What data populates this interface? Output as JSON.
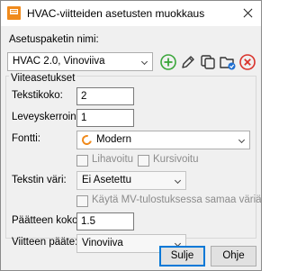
{
  "window": {
    "title": "HVAC-viitteiden asetusten muokkaus"
  },
  "preset": {
    "label": "Asetuspaketin nimi:",
    "value": "HVAC 2.0, Vinoviiva",
    "toolbar": [
      {
        "name": "add",
        "icon": "add-circle-icon",
        "color": "#3aa63a"
      },
      {
        "name": "edit",
        "icon": "pencil-icon",
        "color": "#333333"
      },
      {
        "name": "copy",
        "icon": "copy-icon",
        "color": "#333333"
      },
      {
        "name": "save",
        "icon": "folder-save-icon",
        "color": "#1f6fd1"
      },
      {
        "name": "delete",
        "icon": "delete-circle-icon",
        "color": "#d9322b"
      }
    ]
  },
  "group": {
    "title": "Viiteasetukset",
    "text_size": {
      "label": "Tekstikoko:",
      "value": "2"
    },
    "width_factor": {
      "label": "Leveyskerroin:",
      "value": "1"
    },
    "font": {
      "label": "Fontti:",
      "value": "Modern",
      "icon": "font-icon"
    },
    "bold": {
      "label": "Lihavoitu",
      "checked": false
    },
    "italic": {
      "label": "Kursivoitu",
      "checked": false
    },
    "text_color": {
      "label": "Tekstin väri:",
      "value": "Ei Asetettu"
    },
    "use_mv": {
      "label": "Käytä MV-tulostuksessa samaa väriä",
      "checked": false
    },
    "end_size": {
      "label": "Päätteen koko:",
      "value": "1.5"
    },
    "end_type": {
      "label": "Viitteen pääte:",
      "value": "Vinoviiva"
    }
  },
  "buttons": {
    "close": "Sulje",
    "help": "Ohje"
  },
  "colors": {
    "accent": "#0078d7",
    "brand": "#f08a1c"
  }
}
